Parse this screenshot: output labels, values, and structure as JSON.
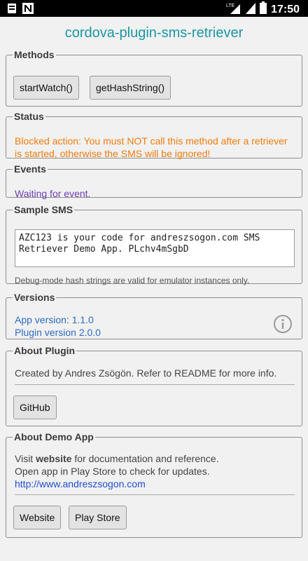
{
  "statusbar": {
    "time": "17:50",
    "network": "LTE",
    "icons": [
      "notification-icon",
      "n-app-icon",
      "lte-signal-icon",
      "signal-icon",
      "battery-icon"
    ]
  },
  "app_title": "cordova-plugin-sms-retriever",
  "methods": {
    "legend": "Methods",
    "start_watch": "startWatch()",
    "get_hash": "getHashString()"
  },
  "status": {
    "legend": "Status",
    "text": "Blocked action: You must NOT call this method after a retriever is started, otherwise the SMS will be ignored!"
  },
  "events": {
    "legend": "Events",
    "text": "Waiting for event."
  },
  "sample_sms": {
    "legend": "Sample SMS",
    "value": "AZC123 is your code for andreszsogon.com SMS Retriever Demo App. PLchv4mSgbD",
    "note": "Debug-mode hash strings are valid for emulator instances only."
  },
  "versions": {
    "legend": "Versions",
    "app_version": "App version: 1.1.0",
    "plugin_version": "Plugin version 2.0.0"
  },
  "about_plugin": {
    "legend": "About Plugin",
    "text": "Created by Andres Zsögön. Refer to README for more info.",
    "github_button": "GitHub"
  },
  "about_app": {
    "legend": "About Demo App",
    "visit_prefix": "Visit ",
    "visit_bold": "website",
    "visit_suffix": " for documentation and reference.",
    "store_text": "Open app in Play Store to check for updates.",
    "url": "http://www.andreszsogon.com",
    "website_button": "Website",
    "playstore_button": "Play Store"
  },
  "colors": {
    "title": "#1b96a5",
    "status_warning": "#ef7d0b",
    "event_text": "#6c3fb6",
    "version_text": "#2d6bc0",
    "link": "#1f4fd0"
  }
}
